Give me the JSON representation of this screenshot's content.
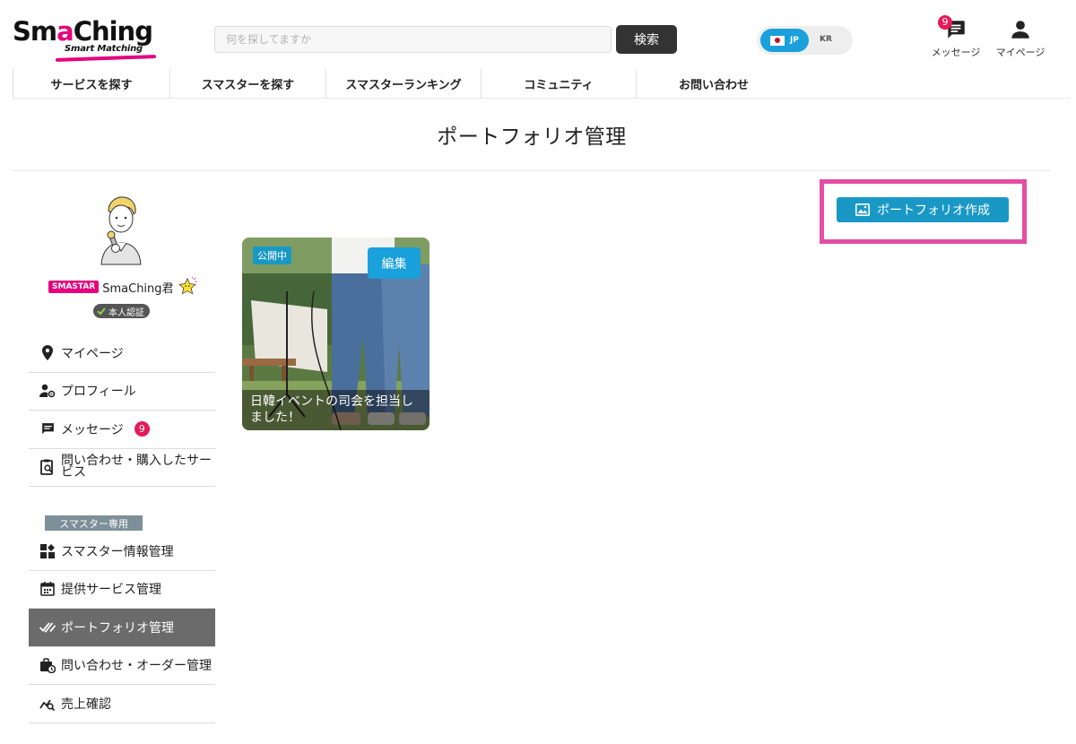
{
  "header": {
    "logo_text_a": "Sm",
    "logo_text_b": "a",
    "logo_text_c": "Ching",
    "logo_subtitle": "Smart Matching",
    "search": {
      "placeholder": "何を探してますか",
      "button_label": "検索"
    },
    "language": {
      "active": "JP",
      "other": "KR"
    },
    "messages": {
      "label": "メッセージ",
      "badge": "9"
    },
    "mypage": {
      "label": "マイページ"
    }
  },
  "nav": {
    "items": [
      "サービスを探す",
      "スマスターを探す",
      "スマスターランキング",
      "コミュニティ",
      "お問い合わせ"
    ]
  },
  "page": {
    "title": "ポートフォリオ管理"
  },
  "profile": {
    "tier_badge": "SMASTAR",
    "name": "SmaChing君",
    "verified_label": "本人認証"
  },
  "sidebar": {
    "items": [
      {
        "label": "マイページ",
        "icon": "location-pin-icon"
      },
      {
        "label": "プロフィール",
        "icon": "user-settings-icon"
      },
      {
        "label": "メッセージ",
        "icon": "message-icon",
        "badge": "9"
      },
      {
        "label": "問い合わせ・購入したサービス",
        "icon": "clipboard-search-icon"
      }
    ],
    "section_label": "スマスター専用",
    "pro_items": [
      {
        "label": "スマスター情報管理",
        "icon": "dashboard-icon"
      },
      {
        "label": "提供サービス管理",
        "icon": "calendar-icon"
      },
      {
        "label": "ポートフォリオ管理",
        "icon": "double-check-icon",
        "active": true
      },
      {
        "label": "問い合わせ・オーダー管理",
        "icon": "briefcase-clock-icon"
      },
      {
        "label": "売上確認",
        "icon": "chart-search-icon"
      }
    ]
  },
  "main": {
    "create_button_label": "ポートフォリオ作成",
    "portfolio_cards": [
      {
        "status": "公開中",
        "edit_label": "編集",
        "caption": "日韓イベントの司会を担当しました！"
      }
    ]
  },
  "colors": {
    "brand_pink": "#e6007e",
    "accent_blue": "#1a98c5",
    "badge_red": "#e6195a",
    "highlight_frame": "#e44ea4",
    "active_menu_bg": "#6b6b6b"
  }
}
